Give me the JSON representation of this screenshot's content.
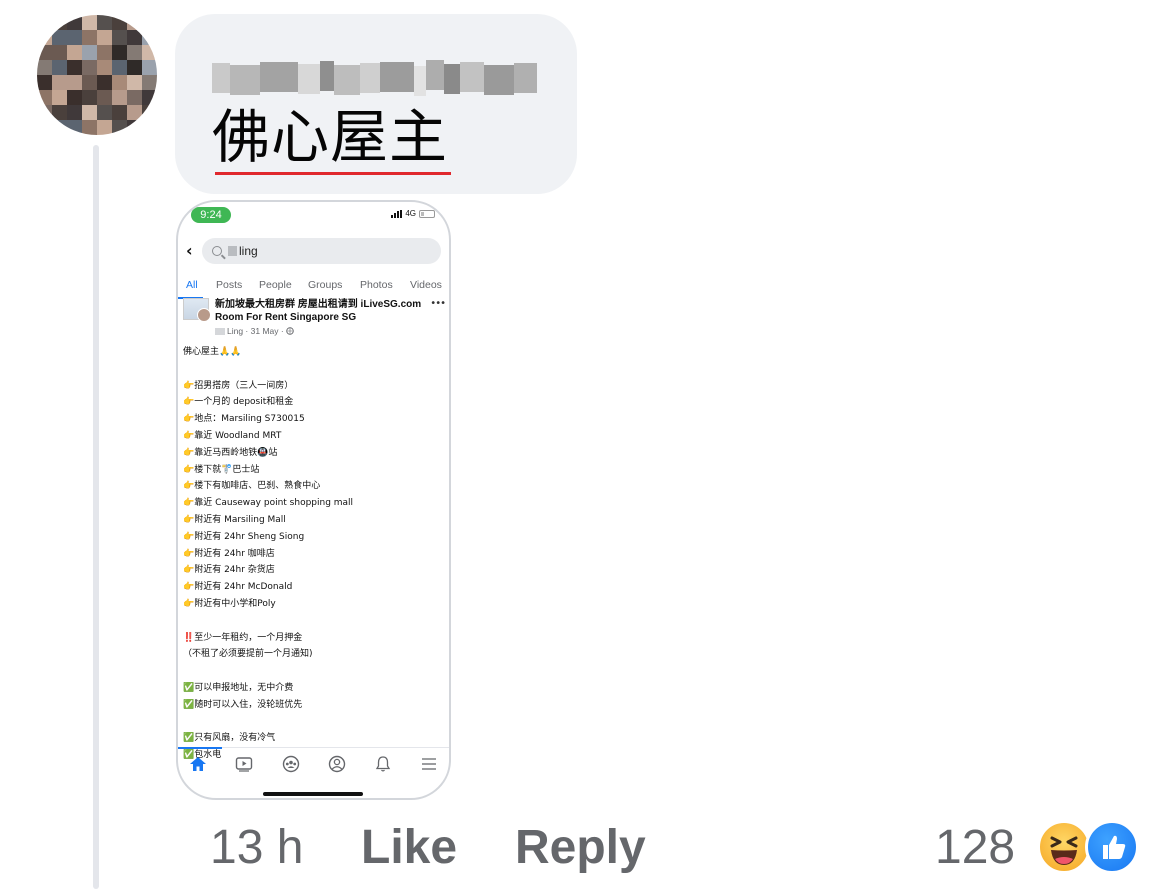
{
  "comment": {
    "text": "佛心屋主",
    "time": "13 h",
    "like_label": "Like",
    "reply_label": "Reply",
    "reaction_count": "128",
    "reactions": [
      "haha-icon",
      "like-icon"
    ]
  },
  "screenshot": {
    "status_time": "9:24",
    "network": "4G",
    "search_query": "ling",
    "tabs": [
      "All",
      "Posts",
      "People",
      "Groups",
      "Photos",
      "Videos"
    ],
    "active_tab": "All",
    "post": {
      "group_name_line1": "新加坡最大租房群 房屋出租请到 iLiveSG.com",
      "group_name_line2": "Room For Rent Singapore SG",
      "meta": "Ling · 31 May · ",
      "lines": [
        "佛心屋主🙏🙏",
        "",
        "👉招男搭房（三人一间房）",
        "👉一个月的 deposit和租金",
        "👉地点：Marsiling S730015",
        "👉靠近 Woodland MRT",
        "👉靠近马西岭地铁🚇站",
        "👉楼下就🚏巴士站",
        "👉楼下有咖啡店、巴刹、熟食中心",
        "👉靠近 Causeway point shopping mall",
        "👉附近有 Marsiling Mall",
        "👉附近有 24hr Sheng Siong",
        "👉附近有 24hr 咖啡店",
        "👉附近有 24hr 杂货店",
        "👉附近有 24hr McDonald",
        "👉附近有中小学和Poly",
        "",
        "‼️至少一年租约，一个月押金",
        "（不租了必须要提前一个月通知)",
        "",
        "✅可以申报地址，无中介费",
        "✅随时可以入住，没轮班优先",
        "",
        "✅只有风扇，没有冷气",
        "✅包水电"
      ]
    },
    "nav_icons": [
      "home-icon",
      "watch-icon",
      "groups-icon",
      "profile-icon",
      "bell-icon",
      "menu-icon"
    ]
  },
  "colors": {
    "accent": "#1877f2",
    "underline": "#e0282d",
    "bubble": "#f0f2f5",
    "muted": "#65676b"
  }
}
